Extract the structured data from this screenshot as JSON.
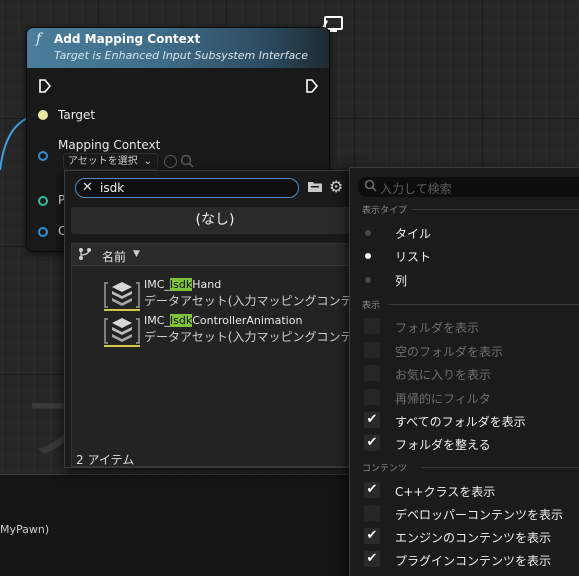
{
  "node": {
    "function_glyph": "f",
    "title": "Add Mapping Context",
    "subtitle": "Target is Enhanced Input Subsystem Interface",
    "pins": {
      "target": "Target",
      "mapping_context": "Mapping Context",
      "truncated_p": "P",
      "truncated_c": "C"
    },
    "asset_select_label": "アセットを選択"
  },
  "picker": {
    "search_value": "isdk",
    "none_label": "(なし)",
    "column_name": "名前",
    "assets": [
      {
        "prefix": "IMC_",
        "match": "Isdk",
        "suffix": "Hand",
        "type": "データアセット(入力マッピングコンテキスト)"
      },
      {
        "prefix": "IMC_",
        "match": "Isdk",
        "suffix": "ControllerAnimation",
        "type": "データアセット(入力マッピングコンテキスト)"
      }
    ],
    "item_count": "2 アイテム"
  },
  "menu": {
    "search_placeholder": "入力して検索",
    "section_view_type": "表示タイプ",
    "view_types": [
      {
        "label": "タイル",
        "selected": false
      },
      {
        "label": "リスト",
        "selected": true
      },
      {
        "label": "列",
        "selected": false
      }
    ],
    "section_display": "表示",
    "display_options": [
      {
        "label": "フォルダを表示",
        "checked": false,
        "enabled": false
      },
      {
        "label": "空のフォルダを表示",
        "checked": false,
        "enabled": false
      },
      {
        "label": "お気に入りを表示",
        "checked": false,
        "enabled": false
      },
      {
        "label": "再帰的にフィルタ",
        "checked": false,
        "enabled": false
      },
      {
        "label": "すべてのフォルダを表示",
        "checked": true,
        "enabled": true
      },
      {
        "label": "フォルダを整える",
        "checked": true,
        "enabled": true
      }
    ],
    "section_content": "コンテンツ",
    "content_options": [
      {
        "label": "C++クラスを表示",
        "checked": true
      },
      {
        "label": "デベロッパーコンテンツを表示",
        "checked": false
      },
      {
        "label": "エンジンのコンテンツを表示",
        "checked": true
      },
      {
        "label": "プラグインコンテンツを表示",
        "checked": true
      }
    ]
  },
  "background": {
    "big_glyph": "フ",
    "lower_text": "MyPawn)"
  },
  "colors": {
    "header_blue": "#4a7e9c",
    "search_focus": "#4e88c7",
    "match_highlight": "#7ec23a",
    "asset_underline": "#d6c74a",
    "object_pin": "#2f8fd6",
    "struct_pin": "#2fbf9f",
    "target_pin": "#e8e8a0"
  },
  "icons": [
    "monitor-icon",
    "exec-pin-icon",
    "clear-icon",
    "folder-icon",
    "gear-icon",
    "branch-icon",
    "sort-arrow-icon",
    "search-icon",
    "data-asset-icon",
    "checkmark-icon"
  ]
}
